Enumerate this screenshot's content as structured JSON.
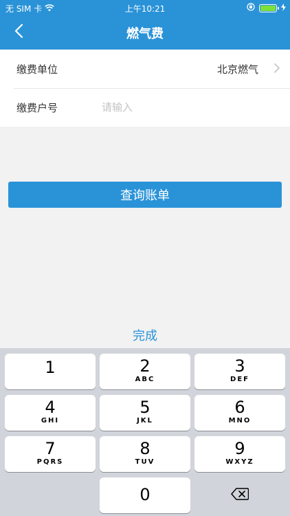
{
  "status_bar": {
    "carrier": "无 SIM 卡",
    "time": "上午10:21",
    "battery_color": "#7ee13b"
  },
  "nav": {
    "title": "燃气费",
    "back_icon": "chevron-left-icon"
  },
  "form": {
    "payee_label": "缴费单位",
    "payee_value": "北京燃气",
    "account_label": "缴费户号",
    "account_placeholder": "请输入",
    "account_value": ""
  },
  "actions": {
    "query_label": "查询账单",
    "done_label": "完成"
  },
  "keypad": {
    "keys": [
      {
        "num": "1",
        "letters": ""
      },
      {
        "num": "2",
        "letters": "ABC"
      },
      {
        "num": "3",
        "letters": "DEF"
      },
      {
        "num": "4",
        "letters": "GHI"
      },
      {
        "num": "5",
        "letters": "JKL"
      },
      {
        "num": "6",
        "letters": "MNO"
      },
      {
        "num": "7",
        "letters": "PQRS"
      },
      {
        "num": "8",
        "letters": "TUV"
      },
      {
        "num": "9",
        "letters": "WXYZ"
      },
      {
        "num": "0",
        "letters": ""
      }
    ],
    "delete_icon": "backspace-icon"
  },
  "colors": {
    "primary": "#2a93d8",
    "background": "#f2f2f2",
    "keyboard_bg": "#d1d4da"
  }
}
